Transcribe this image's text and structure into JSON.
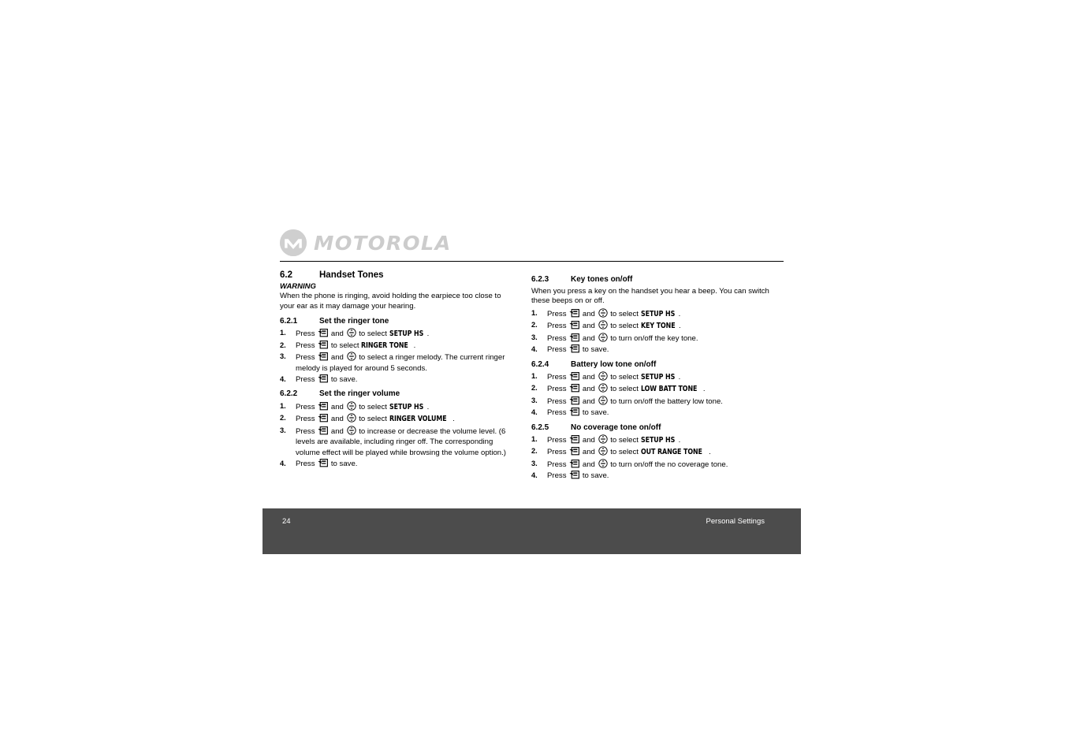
{
  "logo": {
    "brand": "MOTOROLA",
    "mark_alt": "motorola-m-logo"
  },
  "document": {
    "section": {
      "number": "6.2",
      "title": "Handset Tones"
    },
    "warning_label": "WARNING",
    "warning_text": "When the phone is ringing, avoid holding the earpiece too close to your ear as it may damage your hearing."
  },
  "left_column": [
    {
      "number": "6.2.1",
      "title": "Set the ringer tone",
      "steps": [
        {
          "marker": "1.",
          "parts": [
            {
              "t": "text",
              "v": "Press "
            },
            {
              "t": "icon",
              "v": "menu-key-icon"
            },
            {
              "t": "text",
              "v": " and "
            },
            {
              "t": "icon",
              "v": "nav-updown-key-icon"
            },
            {
              "t": "text",
              "v": " to select "
            },
            {
              "t": "lcd",
              "v": "SETUP HS"
            },
            {
              "t": "text",
              "v": "."
            }
          ]
        },
        {
          "marker": "2.",
          "parts": [
            {
              "t": "text",
              "v": "Press "
            },
            {
              "t": "icon",
              "v": "menu-key-icon"
            },
            {
              "t": "text",
              "v": " to select "
            },
            {
              "t": "lcd",
              "v": "RINGER TONE"
            },
            {
              "t": "text",
              "v": "."
            }
          ]
        },
        {
          "marker": "3.",
          "parts": [
            {
              "t": "text",
              "v": "Press "
            },
            {
              "t": "icon",
              "v": "menu-key-icon"
            },
            {
              "t": "text",
              "v": " and "
            },
            {
              "t": "icon",
              "v": "nav-updown-key-icon"
            },
            {
              "t": "text",
              "v": " to select a ringer melody. The current ringer melody is played for around 5 seconds."
            }
          ]
        },
        {
          "marker": "4.",
          "parts": [
            {
              "t": "text",
              "v": "Press "
            },
            {
              "t": "icon",
              "v": "menu-key-icon"
            },
            {
              "t": "text",
              "v": " to save."
            }
          ]
        }
      ]
    },
    {
      "number": "6.2.2",
      "title": "Set the ringer volume",
      "steps": [
        {
          "marker": "1.",
          "parts": [
            {
              "t": "text",
              "v": "Press "
            },
            {
              "t": "icon",
              "v": "menu-key-icon"
            },
            {
              "t": "text",
              "v": " and "
            },
            {
              "t": "icon",
              "v": "nav-updown-key-icon"
            },
            {
              "t": "text",
              "v": " to select "
            },
            {
              "t": "lcd",
              "v": "SETUP HS"
            },
            {
              "t": "text",
              "v": "."
            }
          ]
        },
        {
          "marker": "2.",
          "parts": [
            {
              "t": "text",
              "v": "Press "
            },
            {
              "t": "icon",
              "v": "menu-key-icon"
            },
            {
              "t": "text",
              "v": " and "
            },
            {
              "t": "icon",
              "v": "nav-updown-key-icon"
            },
            {
              "t": "text",
              "v": " to select "
            },
            {
              "t": "lcd",
              "v": "RINGER VOLUME"
            },
            {
              "t": "text",
              "v": "."
            }
          ]
        },
        {
          "marker": "3.",
          "parts": [
            {
              "t": "text",
              "v": "Press "
            },
            {
              "t": "icon",
              "v": "menu-key-icon"
            },
            {
              "t": "text",
              "v": " and "
            },
            {
              "t": "icon",
              "v": "nav-updown-key-icon"
            },
            {
              "t": "text",
              "v": " to increase or decrease the volume level. (6 levels are available, including ringer off. The corresponding volume effect will be played while browsing the volume option.)"
            }
          ]
        },
        {
          "marker": "4.",
          "parts": [
            {
              "t": "text",
              "v": "Press "
            },
            {
              "t": "icon",
              "v": "menu-key-icon"
            },
            {
              "t": "text",
              "v": " to save."
            }
          ]
        }
      ]
    }
  ],
  "right_column": [
    {
      "number": "6.2.3",
      "title": "Key tones on/off",
      "intro": "When you press a key on the handset you hear a beep. You can switch these beeps on or off.",
      "steps": [
        {
          "marker": "1.",
          "parts": [
            {
              "t": "text",
              "v": "Press "
            },
            {
              "t": "icon",
              "v": "menu-key-icon"
            },
            {
              "t": "text",
              "v": " and "
            },
            {
              "t": "icon",
              "v": "nav-updown-key-icon"
            },
            {
              "t": "text",
              "v": " to select "
            },
            {
              "t": "lcd",
              "v": "SETUP HS"
            },
            {
              "t": "text",
              "v": "."
            }
          ]
        },
        {
          "marker": "2.",
          "parts": [
            {
              "t": "text",
              "v": "Press "
            },
            {
              "t": "icon",
              "v": "menu-key-icon"
            },
            {
              "t": "text",
              "v": " and "
            },
            {
              "t": "icon",
              "v": "nav-updown-key-icon"
            },
            {
              "t": "text",
              "v": " to select "
            },
            {
              "t": "lcd",
              "v": "KEY TONE"
            },
            {
              "t": "text",
              "v": "."
            }
          ]
        },
        {
          "marker": "3.",
          "parts": [
            {
              "t": "text",
              "v": "Press "
            },
            {
              "t": "icon",
              "v": "menu-key-icon"
            },
            {
              "t": "text",
              "v": " and "
            },
            {
              "t": "icon",
              "v": "nav-updown-key-icon"
            },
            {
              "t": "text",
              "v": " to turn on/off the key tone."
            }
          ]
        },
        {
          "marker": "4.",
          "parts": [
            {
              "t": "text",
              "v": "Press "
            },
            {
              "t": "icon",
              "v": "menu-key-icon"
            },
            {
              "t": "text",
              "v": " to save."
            }
          ]
        }
      ]
    },
    {
      "number": "6.2.4",
      "title": "Battery low tone on/off",
      "steps": [
        {
          "marker": "1.",
          "parts": [
            {
              "t": "text",
              "v": "Press "
            },
            {
              "t": "icon",
              "v": "menu-key-icon"
            },
            {
              "t": "text",
              "v": " and "
            },
            {
              "t": "icon",
              "v": "nav-updown-key-icon"
            },
            {
              "t": "text",
              "v": " to select "
            },
            {
              "t": "lcd",
              "v": "SETUP HS"
            },
            {
              "t": "text",
              "v": "."
            }
          ]
        },
        {
          "marker": "2.",
          "parts": [
            {
              "t": "text",
              "v": "Press "
            },
            {
              "t": "icon",
              "v": "menu-key-icon"
            },
            {
              "t": "text",
              "v": " and "
            },
            {
              "t": "icon",
              "v": "nav-updown-key-icon"
            },
            {
              "t": "text",
              "v": " to select "
            },
            {
              "t": "lcd",
              "v": "LOW BATT TONE"
            },
            {
              "t": "text",
              "v": "."
            }
          ]
        },
        {
          "marker": "3.",
          "parts": [
            {
              "t": "text",
              "v": "Press "
            },
            {
              "t": "icon",
              "v": "menu-key-icon"
            },
            {
              "t": "text",
              "v": " and "
            },
            {
              "t": "icon",
              "v": "nav-updown-key-icon"
            },
            {
              "t": "text",
              "v": " to turn on/off the battery low tone."
            }
          ]
        },
        {
          "marker": "4.",
          "parts": [
            {
              "t": "text",
              "v": "Press "
            },
            {
              "t": "icon",
              "v": "menu-key-icon"
            },
            {
              "t": "text",
              "v": " to save."
            }
          ]
        }
      ]
    },
    {
      "number": "6.2.5",
      "title": "No coverage tone on/off",
      "steps": [
        {
          "marker": "1.",
          "parts": [
            {
              "t": "text",
              "v": "Press "
            },
            {
              "t": "icon",
              "v": "menu-key-icon"
            },
            {
              "t": "text",
              "v": " and "
            },
            {
              "t": "icon",
              "v": "nav-updown-key-icon"
            },
            {
              "t": "text",
              "v": " to select "
            },
            {
              "t": "lcd",
              "v": "SETUP HS"
            },
            {
              "t": "text",
              "v": "."
            }
          ]
        },
        {
          "marker": "2.",
          "parts": [
            {
              "t": "text",
              "v": "Press "
            },
            {
              "t": "icon",
              "v": "menu-key-icon"
            },
            {
              "t": "text",
              "v": " and "
            },
            {
              "t": "icon",
              "v": "nav-updown-key-icon"
            },
            {
              "t": "text",
              "v": " to select "
            },
            {
              "t": "lcd",
              "v": "OUT RANGE TONE"
            },
            {
              "t": "text",
              "v": "."
            }
          ]
        },
        {
          "marker": "3.",
          "parts": [
            {
              "t": "text",
              "v": "Press "
            },
            {
              "t": "icon",
              "v": "menu-key-icon"
            },
            {
              "t": "text",
              "v": " and "
            },
            {
              "t": "icon",
              "v": "nav-updown-key-icon"
            },
            {
              "t": "text",
              "v": " to turn on/off the no coverage tone."
            }
          ]
        },
        {
          "marker": "4.",
          "parts": [
            {
              "t": "text",
              "v": "Press "
            },
            {
              "t": "icon",
              "v": "menu-key-icon"
            },
            {
              "t": "text",
              "v": " to save."
            }
          ]
        }
      ]
    }
  ],
  "footer": {
    "page_number": "24",
    "chapter_title": "Personal Settings",
    "background_color": "#4c4c4c",
    "text_color": "#ffffff"
  }
}
